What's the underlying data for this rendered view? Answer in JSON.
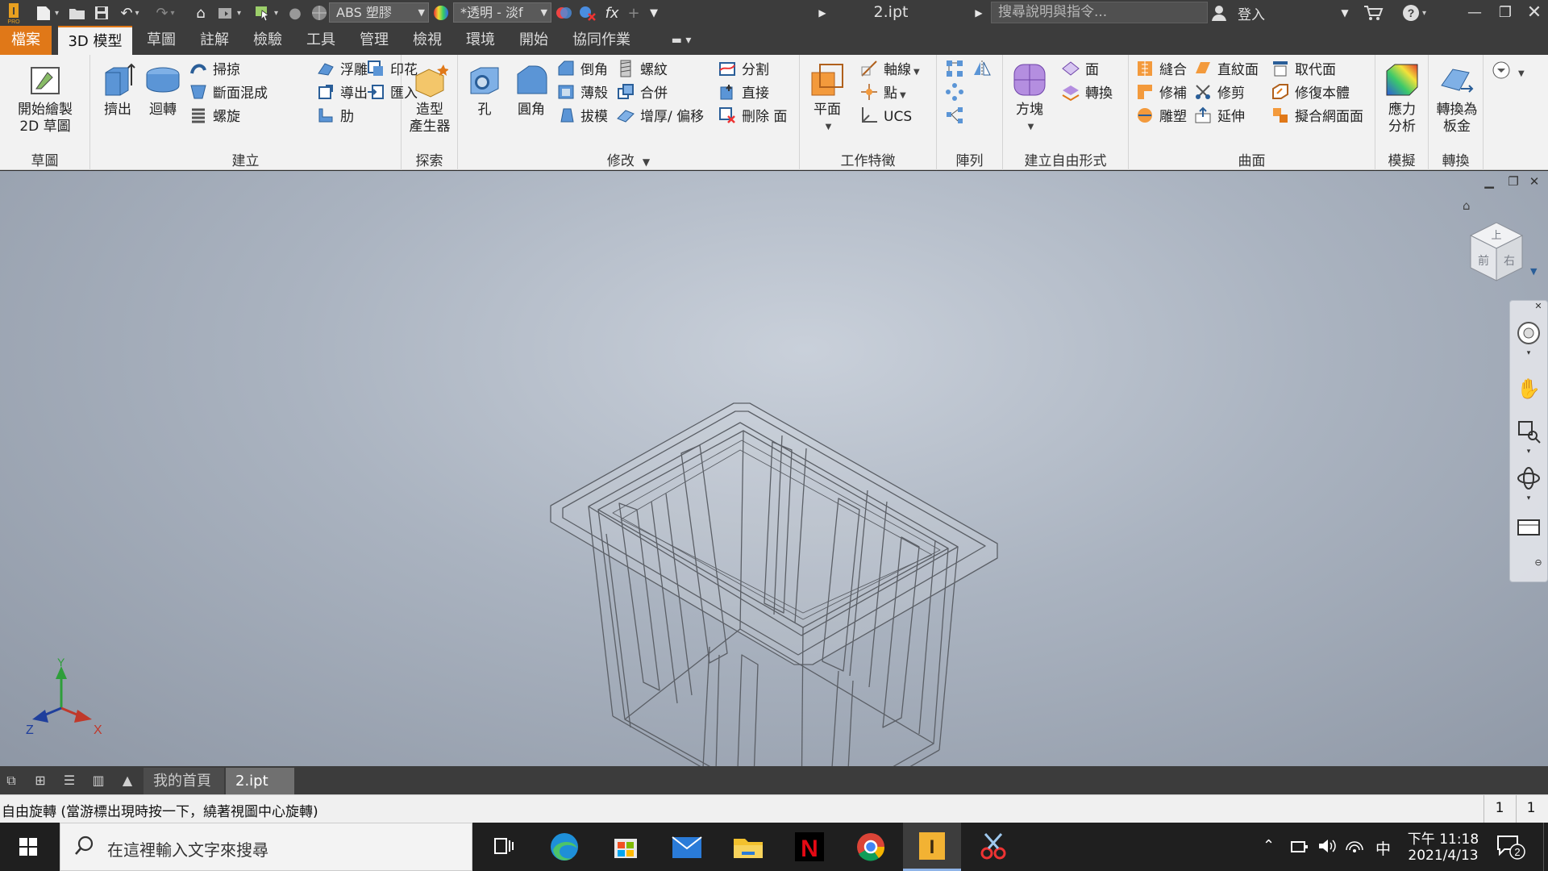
{
  "quick_access": {
    "material_value": "ABS 塑膠",
    "appearance_value": "*透明 - 淡f",
    "fx_label": "fx"
  },
  "document_title": "2.ipt",
  "search": {
    "placeholder": "搜尋說明與指令..."
  },
  "account": {
    "signin_label": "登入"
  },
  "tabs": [
    {
      "label": "檔案"
    },
    {
      "label": "3D 模型"
    },
    {
      "label": "草圖"
    },
    {
      "label": "註解"
    },
    {
      "label": "檢驗"
    },
    {
      "label": "工具"
    },
    {
      "label": "管理"
    },
    {
      "label": "檢視"
    },
    {
      "label": "環境"
    },
    {
      "label": "開始"
    },
    {
      "label": "協同作業"
    }
  ],
  "ribbon": {
    "sketch": {
      "title": "草圖",
      "start_sketch": "開始繪製\n2D 草圖"
    },
    "create": {
      "title": "建立",
      "extrude": "擠出",
      "revolve": "迴轉",
      "sweep": "掃掠",
      "loft": "斷面混成",
      "coil": "螺旋",
      "emboss": "浮雕",
      "derive": "導出",
      "rib": "肋",
      "decal": "印花",
      "import": "匯入"
    },
    "explore": {
      "title": "探索",
      "shape_generator": "造型\n產生器"
    },
    "modify": {
      "title": "修改",
      "hole": "孔",
      "fillet": "圓角",
      "chamfer": "倒角",
      "shell": "薄殼",
      "draft": "拔模",
      "thread": "螺紋",
      "combine": "合併",
      "thicken": "增厚/ 偏移",
      "split": "分割",
      "direct": "直接",
      "delete_face": "刪除 面"
    },
    "work_features": {
      "title": "工作特徵",
      "plane": "平面",
      "axis": "軸線",
      "point": "點",
      "ucs": "UCS"
    },
    "pattern": {
      "title": "陣列"
    },
    "freeform": {
      "title": "建立自由形式",
      "box": "方塊",
      "face": "面",
      "convert": "轉換"
    },
    "surface": {
      "title": "曲面",
      "stitch": "縫合",
      "patch": "修補",
      "sculpt": "雕塑",
      "ruled": "直紋面",
      "trim": "修剪",
      "extend": "延伸",
      "replace_face": "取代面",
      "repair_bodies": "修復本體",
      "fit_mesh": "擬合網面面"
    },
    "simulation": {
      "title": "模擬",
      "stress": "應力\n分析"
    },
    "convert": {
      "title": "轉換",
      "to_sheet_metal": "轉換為\n板金"
    }
  },
  "viewcube": {
    "face_front": "前",
    "face_right": "右",
    "face_top": "上"
  },
  "triad": {
    "x": "X",
    "y": "Y",
    "z": "Z"
  },
  "document_tabs": {
    "home": "我的首頁",
    "active": "2.ipt",
    "close": "✕"
  },
  "status": {
    "text": "自由旋轉 (當游標出現時按一下，繞著視圖中心旋轉)",
    "count1": "1",
    "count2": "1"
  },
  "taskbar": {
    "search_placeholder": "在這裡輸入文字來搜尋",
    "time": "下午 11:18",
    "date": "2021/4/13",
    "ime": "中",
    "notifications": "2"
  },
  "colors": {
    "accent": "#e07818",
    "viewport_center": "#c9d0da",
    "viewport_edge": "#8e97a5"
  }
}
